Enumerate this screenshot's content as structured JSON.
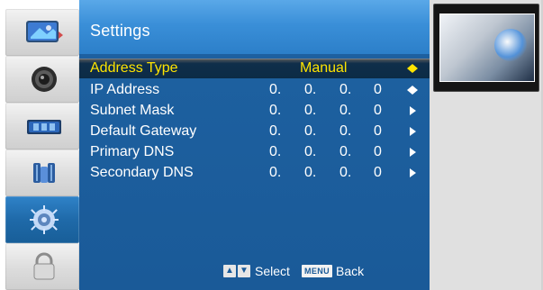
{
  "sidebar": {
    "items": [
      {
        "name": "picture"
      },
      {
        "name": "audio"
      },
      {
        "name": "time"
      },
      {
        "name": "parental"
      },
      {
        "name": "settings",
        "active": true
      },
      {
        "name": "lock"
      }
    ]
  },
  "panel": {
    "title": "Settings",
    "rows": [
      {
        "label": "Address Type",
        "value": "Manual",
        "active": true
      },
      {
        "label": "IP Address",
        "o1": "0.",
        "o2": "0.",
        "o3": "0.",
        "o4": "0"
      },
      {
        "label": "Subnet Mask",
        "o1": "0.",
        "o2": "0.",
        "o3": "0.",
        "o4": "0"
      },
      {
        "label": "Default Gateway",
        "o1": "0.",
        "o2": "0.",
        "o3": "0.",
        "o4": "0"
      },
      {
        "label": "Primary DNS",
        "o1": "0.",
        "o2": "0.",
        "o3": "0.",
        "o4": "0"
      },
      {
        "label": "Secondary DNS",
        "o1": "0.",
        "o2": "0.",
        "o3": "0.",
        "o4": "0"
      }
    ],
    "footer": {
      "select_label": "Select",
      "menu_key": "MENU",
      "back_label": "Back"
    }
  },
  "colors": {
    "accent_blue": "#1a5a98",
    "highlight_yellow": "#ffe400"
  }
}
